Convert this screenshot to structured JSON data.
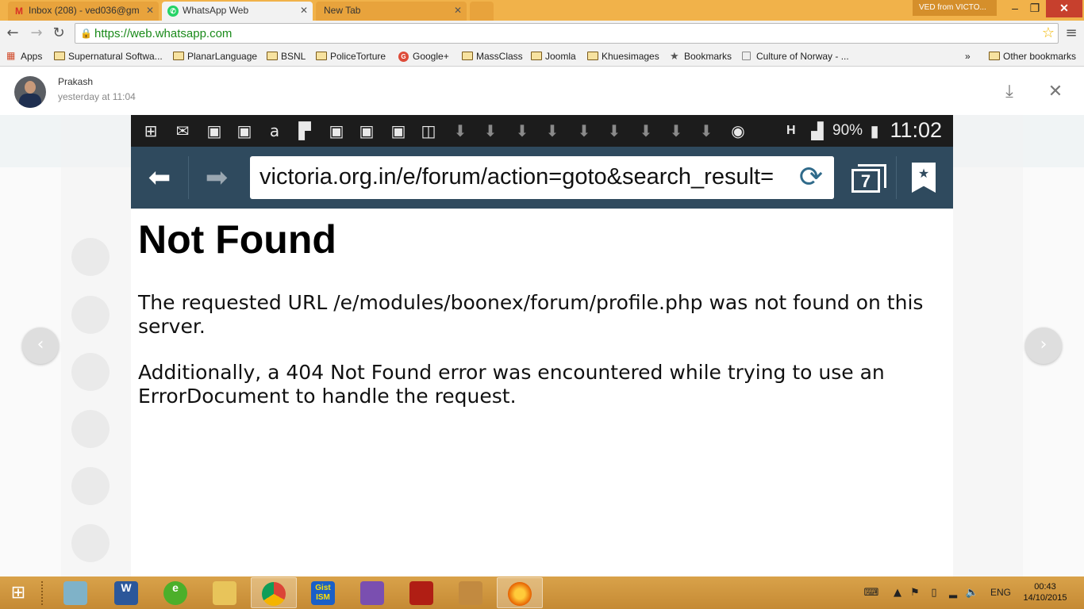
{
  "browser": {
    "tabs": [
      {
        "label": "Inbox (208) - ved036@gm",
        "icon": "gmail-icon"
      },
      {
        "label": "WhatsApp Web",
        "icon": "whatsapp-icon"
      },
      {
        "label": "New Tab"
      }
    ],
    "profile_label": "VED from VICTO...",
    "url": "https://web.whatsapp.com",
    "bookmarks": [
      {
        "label": "Apps",
        "icon": "apps-grid-icon"
      },
      {
        "label": "Supernatural Softwa...",
        "icon": "folder-icon"
      },
      {
        "label": "PlanarLanguage",
        "icon": "folder-icon"
      },
      {
        "label": "BSNL",
        "icon": "folder-icon"
      },
      {
        "label": "PoliceTorture",
        "icon": "folder-icon"
      },
      {
        "label": "Google+",
        "icon": "google-plus-icon"
      },
      {
        "label": "MassClass",
        "icon": "folder-icon"
      },
      {
        "label": "Joomla",
        "icon": "folder-icon"
      },
      {
        "label": "Khuesimages",
        "icon": "folder-icon"
      },
      {
        "label": "Bookmarks",
        "icon": "star-icon"
      },
      {
        "label": "Culture of Norway - ...",
        "icon": "page-icon"
      }
    ],
    "overflow_label": "»",
    "other_bookmarks": "Other bookmarks"
  },
  "viewer": {
    "sender_name": "Prakash",
    "timestamp": "yesterday at 11:04",
    "download_icon": "download-icon",
    "close_icon": "close-icon",
    "prev_icon": "chevron-left-icon",
    "next_icon": "chevron-right-icon"
  },
  "phone": {
    "battery": "90%",
    "network": "H",
    "clock": "11:02",
    "url": "victoria.org.in/e/forum/action=goto&search_result=",
    "tab_count": "7",
    "heading": "Not Found",
    "paragraph1": "The requested URL /e/modules/boonex/forum/profile.php was not found on this server.",
    "paragraph2": "Additionally, a 404 Not Found error was encountered while trying to use an ErrorDocument to handle the request."
  },
  "taskbar": {
    "apps": [
      {
        "icon": "notepad-icon",
        "label": ""
      },
      {
        "icon": "word-icon",
        "label": "W"
      },
      {
        "icon": "browser-e-icon",
        "label": "e"
      },
      {
        "icon": "file-explorer-icon",
        "label": ""
      },
      {
        "icon": "chrome-icon",
        "label": ""
      },
      {
        "icon": "gist-ism-icon",
        "label": "Gist ISM"
      },
      {
        "icon": "winrar-icon",
        "label": ""
      },
      {
        "icon": "acrobat-icon",
        "label": ""
      },
      {
        "icon": "app-icon",
        "label": ""
      },
      {
        "icon": "firefox-icon",
        "label": ""
      }
    ],
    "language": "ENG",
    "time": "00:43",
    "date": "14/10/2015"
  },
  "colors": {
    "tabstrip": "#f1b24a",
    "taskbar": "#d9a24a",
    "phone_toolbar": "#2f4a5e",
    "phone_statusbar": "#1c1c1c",
    "url_green": "#1a8a1a"
  }
}
